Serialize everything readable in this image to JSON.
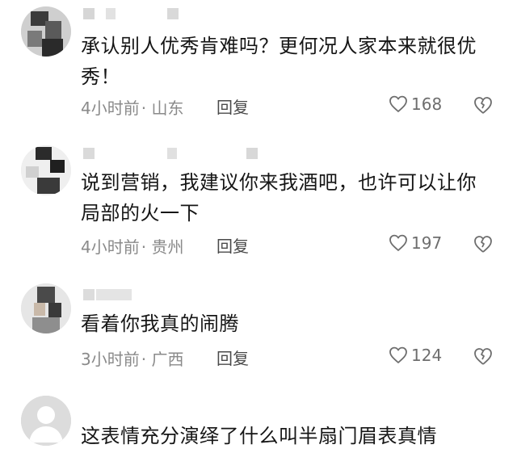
{
  "comments": [
    {
      "text": "承认别人优秀肯难吗？更何况人家本来就很优秀！",
      "time": "4小时前",
      "location": "· 山东",
      "reply_label": "回复",
      "likes": "168",
      "avatar": "pixelated",
      "username": "pixelated"
    },
    {
      "text": "说到营销，我建议你来我酒吧，也许可以让你局部的火一下",
      "time": "4小时前",
      "location": "· 贵州",
      "reply_label": "回复",
      "likes": "197",
      "avatar": "pixelated",
      "username": "pixelated"
    },
    {
      "text": "看着你我真的闹腾",
      "time": "3小时前",
      "location": "· 广西",
      "reply_label": "回复",
      "likes": "124",
      "avatar": "pixelated",
      "username": "pixelated"
    },
    {
      "text": "这表情充分演绎了什么叫半扇门眉表真情",
      "avatar": "default-user",
      "username": "none"
    }
  ],
  "icons": {
    "like": "heart-outline-icon",
    "dislike": "broken-heart-icon"
  },
  "colors": {
    "text": "#161616",
    "meta": "#8a8a8a",
    "icon": "#6e6e6e"
  }
}
